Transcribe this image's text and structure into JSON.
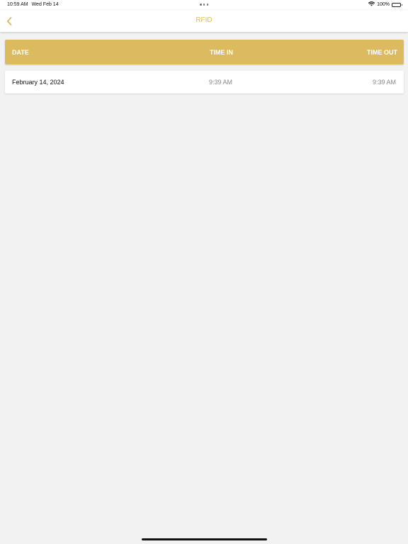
{
  "status_bar": {
    "time": "10:59 AM",
    "date": "Wed Feb 14",
    "battery": "100%"
  },
  "nav": {
    "title": "RFID"
  },
  "table": {
    "columns": [
      "DATE",
      "TIME IN",
      "TIME OUT"
    ],
    "rows": [
      {
        "date": "February 14, 2024",
        "time_in": "9:39 AM",
        "time_out": "9:39 AM"
      }
    ]
  },
  "colors": {
    "accent": "#dcbb60",
    "background": "#f2f2f2"
  }
}
